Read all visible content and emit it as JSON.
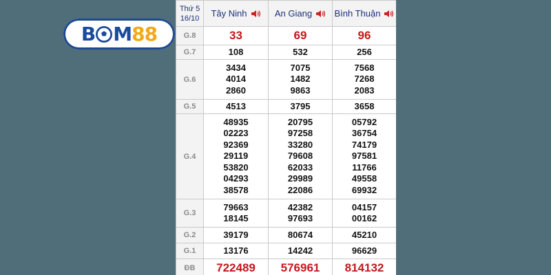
{
  "brand": {
    "logo_text_blue": "B",
    "logo_text_blue2": "M",
    "logo_text_gold": "88"
  },
  "header": {
    "day": "Thứ 5",
    "date": "16/10",
    "provinces": [
      "Tây Ninh",
      "An Giang",
      "Bình Thuận"
    ]
  },
  "prizes": [
    {
      "label": "G.8",
      "values": [
        [
          "33"
        ],
        [
          "69"
        ],
        [
          "96"
        ]
      ]
    },
    {
      "label": "G.7",
      "values": [
        [
          "108"
        ],
        [
          "532"
        ],
        [
          "256"
        ]
      ]
    },
    {
      "label": "G.6",
      "values": [
        [
          "3434",
          "4014",
          "2860"
        ],
        [
          "7075",
          "1482",
          "9863"
        ],
        [
          "7568",
          "7268",
          "2083"
        ]
      ]
    },
    {
      "label": "G.5",
      "values": [
        [
          "4513"
        ],
        [
          "3795"
        ],
        [
          "3658"
        ]
      ]
    },
    {
      "label": "G.4",
      "values": [
        [
          "48935",
          "02223",
          "92369",
          "29119",
          "53820",
          "04293",
          "38578"
        ],
        [
          "20795",
          "97258",
          "33280",
          "79608",
          "62033",
          "29989",
          "22086"
        ],
        [
          "05792",
          "36754",
          "74179",
          "97581",
          "11766",
          "49558",
          "69932"
        ]
      ]
    },
    {
      "label": "G.3",
      "values": [
        [
          "79663",
          "18145"
        ],
        [
          "42382",
          "97693"
        ],
        [
          "04157",
          "00162"
        ]
      ]
    },
    {
      "label": "G.2",
      "values": [
        [
          "39179"
        ],
        [
          "80674"
        ],
        [
          "45210"
        ]
      ]
    },
    {
      "label": "G.1",
      "values": [
        [
          "13176"
        ],
        [
          "14242"
        ],
        [
          "96629"
        ]
      ]
    },
    {
      "label": "ĐB",
      "values": [
        [
          "722489"
        ],
        [
          "576961"
        ],
        [
          "814132"
        ]
      ]
    }
  ],
  "colors": {
    "accent_red": "#c5161d",
    "header_blue": "#1c2f7a",
    "background": "#4f6e79"
  },
  "icons": {
    "speaker": "speaker-icon"
  }
}
